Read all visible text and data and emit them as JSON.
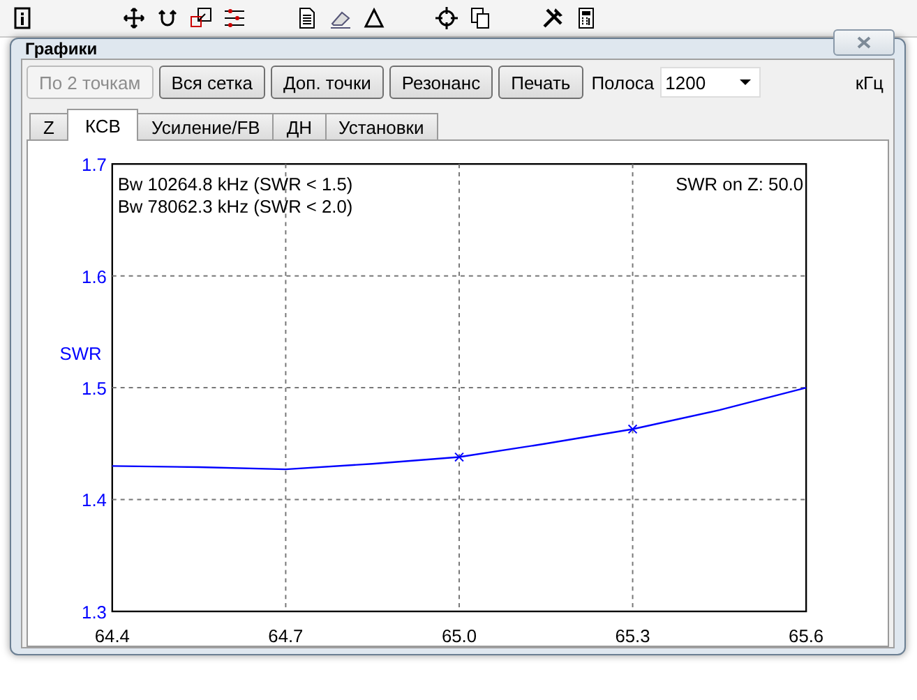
{
  "window": {
    "title": "Графики"
  },
  "buttons": [
    {
      "label": "По 2 точкам",
      "disabled": true
    },
    {
      "label": "Вся сетка",
      "disabled": false
    },
    {
      "label": "Доп. точки",
      "disabled": false
    },
    {
      "label": "Резонанс",
      "disabled": false
    },
    {
      "label": "Печать",
      "disabled": false
    }
  ],
  "band": {
    "label": "Полоса",
    "value": "1200",
    "unit": "кГц"
  },
  "tabs": [
    {
      "label": "Z",
      "selected": false
    },
    {
      "label": "КСВ",
      "selected": true
    },
    {
      "label": "Усиление/FB",
      "selected": false
    },
    {
      "label": "ДН",
      "selected": false
    },
    {
      "label": "Установки",
      "selected": false
    }
  ],
  "chart": {
    "notes": [
      "Bw 10264.8 kHz (SWR < 1.5)",
      "Bw 78062.3 kHz (SWR < 2.0)"
    ],
    "z_note": "SWR on Z: 50.0",
    "chart_data": {
      "type": "line",
      "ylabel": "SWR",
      "x": [
        64.4,
        64.55,
        64.7,
        64.85,
        65.0,
        65.15,
        65.3,
        65.45,
        65.6
      ],
      "grid": true,
      "series": [
        {
          "color": "#0000ff",
          "values": [
            1.43,
            1.429,
            1.427,
            1.432,
            1.438,
            1.45,
            1.463,
            1.48,
            1.5
          ]
        }
      ],
      "xlim": [
        64.4,
        65.6
      ],
      "ylim": [
        1.3,
        1.7
      ],
      "xticks": [
        {
          "value": 64.4,
          "label": "64.4"
        },
        {
          "value": 64.7,
          "label": "64.7"
        },
        {
          "value": 65.0,
          "label": "65.0"
        },
        {
          "value": 65.3,
          "label": "65.3"
        },
        {
          "value": 65.6,
          "label": "65.6"
        }
      ],
      "yticks": [
        {
          "value": 1.3,
          "label": "1.3"
        },
        {
          "value": 1.4,
          "label": "1.4"
        },
        {
          "value": 1.5,
          "label": "1.5"
        },
        {
          "value": 1.6,
          "label": "1.6"
        },
        {
          "value": 1.7,
          "label": "1.7"
        }
      ]
    }
  }
}
